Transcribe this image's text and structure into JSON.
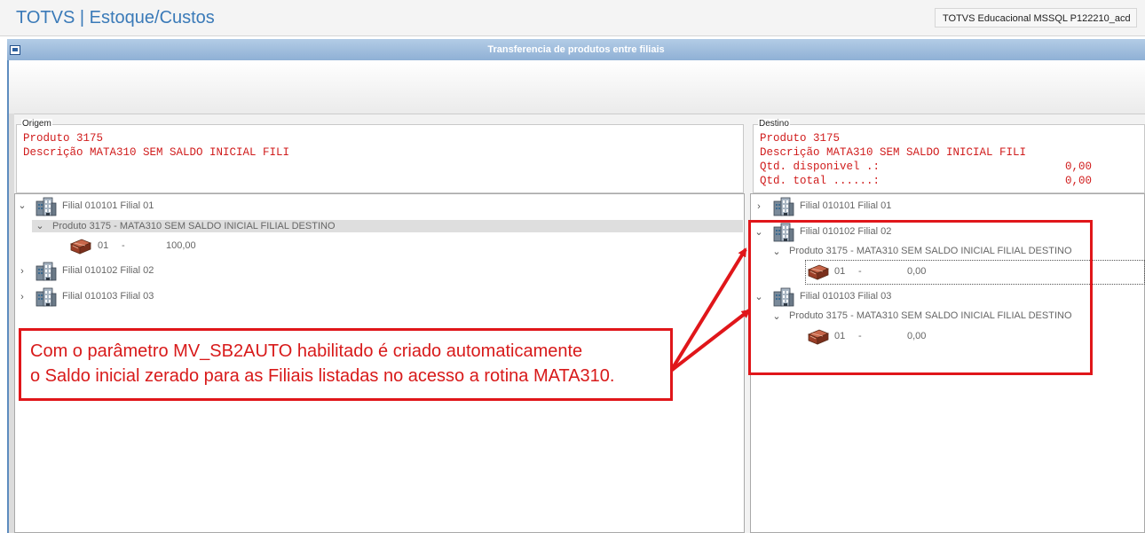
{
  "app": {
    "title": "TOTVS | Estoque/Custos",
    "environment": "TOTVS Educacional MSSQL P122210_acd"
  },
  "dialog": {
    "title": "Transferencia de produtos entre filiais"
  },
  "origem": {
    "legend": "Origem",
    "product_line": "Produto 3175",
    "description_line": "Descrição MATA310 SEM SALDO INICIAL FILI",
    "tree": {
      "filial_1": "Filial 010101 Filial 01",
      "product_node": "Produto 3175 - MATA310 SEM SALDO INICIAL FILIAL DESTINO",
      "stock_code": "01",
      "stock_sep": "-",
      "stock_qty": "100,00",
      "filial_2": "Filial 010102 Filial 02",
      "filial_3": "Filial 010103 Filial 03"
    }
  },
  "destino": {
    "legend": "Destino",
    "product_line": "Produto 3175",
    "description_line": "Descrição MATA310 SEM SALDO INICIAL FILI",
    "qtd_disponivel_label": "Qtd. disponivel .:",
    "qtd_disponivel_value": "0,00",
    "qtd_total_label": "Qtd. total ......:",
    "qtd_total_value": "0,00",
    "tree": {
      "filial_1": "Filial 010101 Filial 01",
      "filial_2": "Filial 010102 Filial 02",
      "product_node_2": "Produto 3175 - MATA310 SEM SALDO INICIAL FILIAL DESTINO",
      "stock_code_2": "01",
      "stock_sep_2": "-",
      "stock_qty_2": "0,00",
      "filial_3": "Filial 010103 Filial 03",
      "product_node_3": "Produto 3175 - MATA310 SEM SALDO INICIAL FILIAL DESTINO",
      "stock_code_3": "01",
      "stock_sep_3": "-",
      "stock_qty_3": "0,00"
    }
  },
  "annotation": {
    "line1": "Com o parâmetro MV_SB2AUTO habilitado é criado automaticamente",
    "line2": "o Saldo inicial zerado para as Filiais listadas no acesso a rotina MATA310.",
    "color": "#e0161a"
  },
  "icons": {
    "expanded": "chevron-down-icon",
    "collapsed": "chevron-right-icon",
    "branch": "building-icon",
    "stock": "stock-box-icon"
  }
}
